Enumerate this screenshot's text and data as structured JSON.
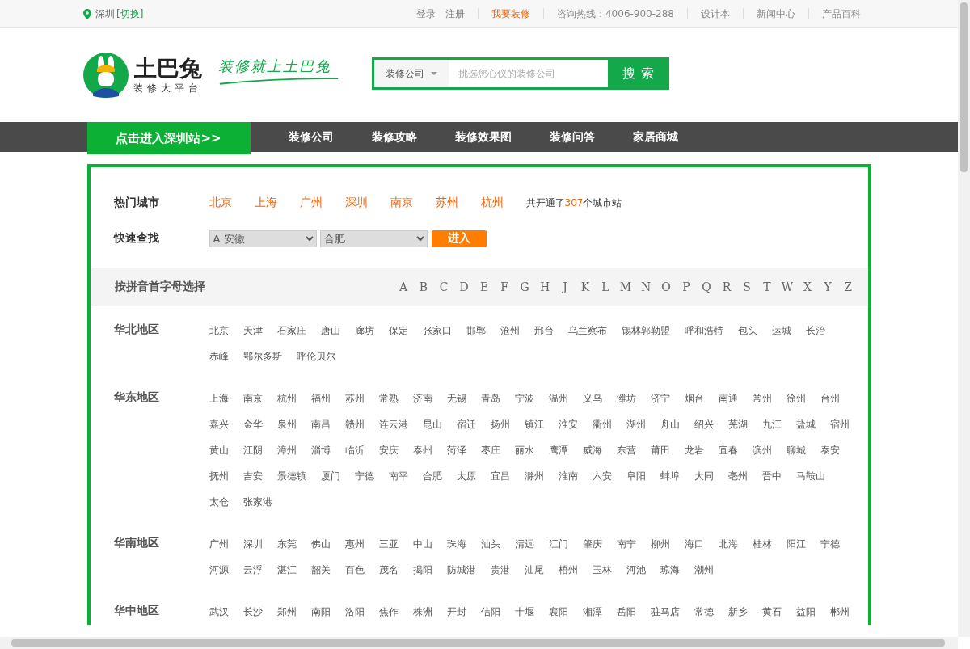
{
  "top_bar": {
    "location": "深圳",
    "switch_link": "[切换]",
    "link_groups": [
      [
        {
          "label": "登录",
          "highlight": false
        },
        {
          "label": "注册",
          "highlight": false
        }
      ],
      [
        {
          "label": "我要装修",
          "highlight": true
        }
      ],
      [
        {
          "label": "咨询热线：4006-900-288",
          "highlight": false
        }
      ],
      [
        {
          "label": "设计本",
          "highlight": false
        }
      ],
      [
        {
          "label": "新闻中心",
          "highlight": false
        }
      ],
      [
        {
          "label": "产品百科",
          "highlight": false
        }
      ]
    ]
  },
  "header": {
    "brand": "土巴兔",
    "tagline": "装修大平台",
    "slogan": "装修就上土巴兔",
    "search": {
      "category": "装修公司",
      "placeholder": "挑选您心仪的装修公司",
      "button": "搜 索"
    }
  },
  "nav": {
    "station_button": "点击进入深圳站>>",
    "items": [
      "装修公司",
      "装修攻略",
      "装修效果图",
      "装修问答",
      "家居商城"
    ]
  },
  "hot_cities": {
    "label": "热门城市",
    "cities": [
      "北京",
      "上海",
      "广州",
      "深圳",
      "南京",
      "苏州",
      "杭州"
    ],
    "summary_prefix": "共开通了",
    "count": "307",
    "summary_suffix": "个城市站"
  },
  "quick_find": {
    "label": "快速查找",
    "province": "A 安徽",
    "city": "合肥",
    "button": "进入"
  },
  "letter_bar": {
    "label": "按拼音首字母选择",
    "letters": [
      "A",
      "B",
      "C",
      "D",
      "E",
      "F",
      "G",
      "H",
      "J",
      "K",
      "L",
      "M",
      "N",
      "O",
      "P",
      "Q",
      "R",
      "S",
      "T",
      "W",
      "X",
      "Y",
      "Z"
    ]
  },
  "regions": [
    {
      "name": "华北地区",
      "cities": [
        "北京",
        "天津",
        "石家庄",
        "唐山",
        "廊坊",
        "保定",
        "张家口",
        "邯郸",
        "沧州",
        "邢台",
        "乌兰察布",
        "锡林郭勒盟",
        "呼和浩特",
        "包头",
        "运城",
        "长治",
        "赤峰",
        "鄂尔多斯",
        "呼伦贝尔"
      ]
    },
    {
      "name": "华东地区",
      "cities": [
        "上海",
        "南京",
        "杭州",
        "福州",
        "苏州",
        "常熟",
        "济南",
        "无锡",
        "青岛",
        "宁波",
        "温州",
        "义乌",
        "潍坊",
        "济宁",
        "烟台",
        "南通",
        "常州",
        "徐州",
        "台州",
        "嘉兴",
        "金华",
        "泉州",
        "南昌",
        "赣州",
        "连云港",
        "昆山",
        "宿迁",
        "扬州",
        "镇江",
        "淮安",
        "衢州",
        "湖州",
        "舟山",
        "绍兴",
        "芜湖",
        "九江",
        "盐城",
        "宿州",
        "黄山",
        "江阴",
        "漳州",
        "淄博",
        "临沂",
        "安庆",
        "泰州",
        "菏泽",
        "枣庄",
        "丽水",
        "鹰潭",
        "威海",
        "东营",
        "莆田",
        "龙岩",
        "宜春",
        "滨州",
        "聊城",
        "泰安",
        "抚州",
        "吉安",
        "景德镇",
        "厦门",
        "宁德",
        "南平",
        "合肥",
        "太原",
        "宜昌",
        "滁州",
        "淮南",
        "六安",
        "阜阳",
        "蚌埠",
        "大同",
        "亳州",
        "晋中",
        "马鞍山",
        "太仓",
        "张家港"
      ]
    },
    {
      "name": "华南地区",
      "cities": [
        "广州",
        "深圳",
        "东莞",
        "佛山",
        "惠州",
        "三亚",
        "中山",
        "珠海",
        "汕头",
        "清远",
        "江门",
        "肇庆",
        "南宁",
        "柳州",
        "海口",
        "北海",
        "桂林",
        "阳江",
        "宁德",
        "河源",
        "云浮",
        "湛江",
        "韶关",
        "百色",
        "茂名",
        "揭阳",
        "防城港",
        "贵港",
        "汕尾",
        "梧州",
        "玉林",
        "河池",
        "琼海",
        "潮州"
      ]
    },
    {
      "name": "华中地区",
      "cities": [
        "武汉",
        "长沙",
        "郑州",
        "南阳",
        "洛阳",
        "焦作",
        "株洲",
        "开封",
        "信阳",
        "十堰",
        "襄阳",
        "湘潭",
        "岳阳",
        "驻马店",
        "常德",
        "新乡",
        "黄石",
        "益阳",
        "郴州"
      ]
    }
  ]
}
